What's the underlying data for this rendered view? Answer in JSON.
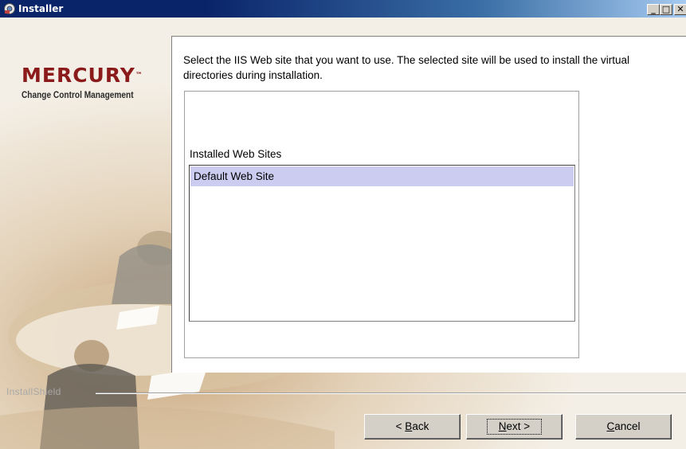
{
  "window": {
    "title": "Installer"
  },
  "titlebar_buttons": {
    "minimize": "_",
    "maximize": "□",
    "close": "✕"
  },
  "brand": {
    "logo": "MERCURY",
    "trademark": "™",
    "tagline": "Change Control Management"
  },
  "content": {
    "instruction": "Select the IIS Web site that you want to use. The selected site will be used to install the virtual directories during installation.",
    "list_label": "Installed Web Sites",
    "sites": [
      "Default Web Site"
    ],
    "selected_site": "Default Web Site"
  },
  "footer": {
    "installshield_label": "InstallShield"
  },
  "buttons": {
    "back": {
      "prefix": "< ",
      "mnemonic": "B",
      "rest": "ack"
    },
    "next": {
      "prefix": "",
      "mnemonic": "N",
      "rest": "ext >"
    },
    "cancel": {
      "prefix": "",
      "mnemonic": "C",
      "rest": "ancel"
    }
  },
  "colors": {
    "titlebar": "#0a246a",
    "selection": "#ccccf0",
    "logo": "#8b1a1a",
    "face": "#d4d0c8"
  }
}
